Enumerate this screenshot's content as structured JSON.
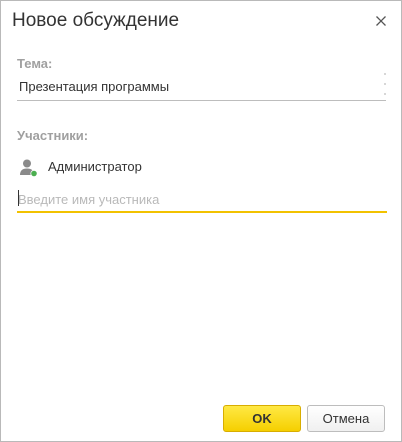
{
  "dialog": {
    "title": "Новое обсуждение"
  },
  "topic": {
    "label": "Тема:",
    "value": "Презентация программы"
  },
  "participants": {
    "label": "Участники:",
    "members": [
      {
        "name": "Администратор",
        "status": "online"
      }
    ],
    "input_placeholder": "Введите имя участника",
    "input_value": ""
  },
  "buttons": {
    "ok_label": "OK",
    "cancel_label": "Отмена"
  },
  "colors": {
    "accent": "#f5cf00",
    "online": "#4caf50",
    "label": "#a0a0a0"
  },
  "icons": {
    "close": "close-icon",
    "avatar": "user-avatar-icon",
    "status": "online-status-icon"
  }
}
